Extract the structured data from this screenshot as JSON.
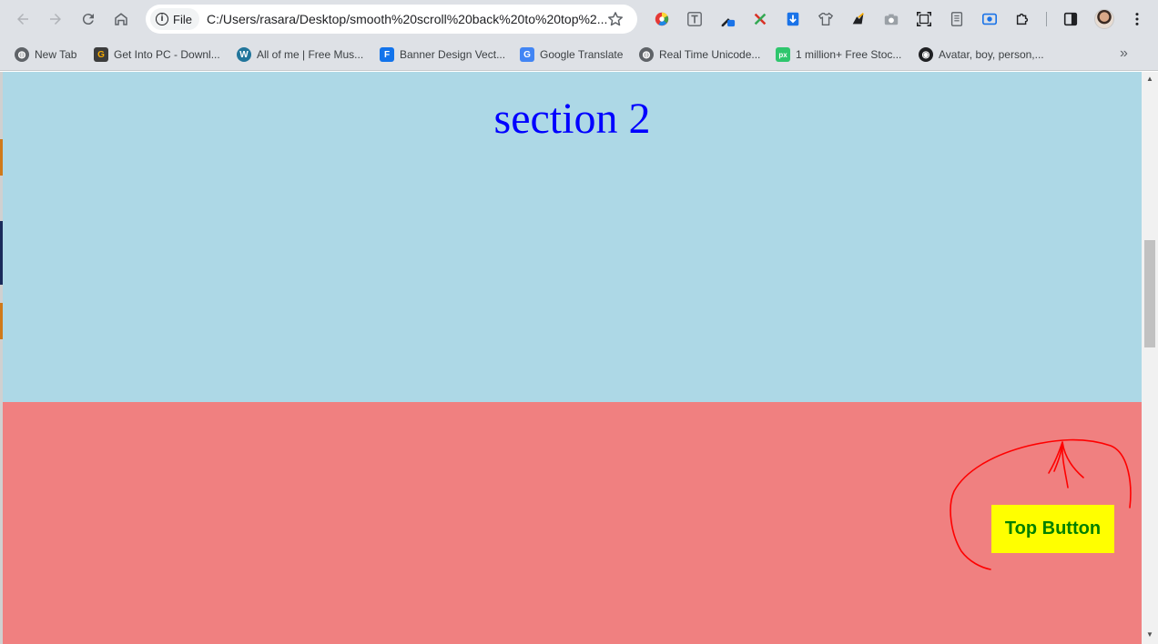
{
  "browser": {
    "site_chip_label": "File",
    "url": "C:/Users/rasara/Desktop/smooth%20scroll%20back%20to%20top%2...",
    "bookmarks": [
      {
        "label": "New Tab",
        "icon": "globe-icon"
      },
      {
        "label": "Get Into PC - Downl...",
        "icon": "getintopc-icon"
      },
      {
        "label": "All of me | Free Mus...",
        "icon": "wordpress-icon"
      },
      {
        "label": "Banner Design Vect...",
        "icon": "freepik-icon"
      },
      {
        "label": "Google Translate",
        "icon": "google-translate-icon"
      },
      {
        "label": "Real Time Unicode...",
        "icon": "globe-icon"
      },
      {
        "label": "1 million+ Free Stoc...",
        "icon": "pixabay-icon"
      },
      {
        "label": "Avatar, boy, person,...",
        "icon": "eye-icon"
      }
    ],
    "more_bookmarks": "»"
  },
  "page": {
    "section2_heading": "section 2",
    "top_button_label": "Top Button"
  },
  "colors": {
    "section2_bg": "#add8e6",
    "section3_bg": "#f08080",
    "heading": "#0000ff",
    "button_bg": "#ffff00",
    "button_text": "#008000",
    "annotation": "#ff0000"
  }
}
